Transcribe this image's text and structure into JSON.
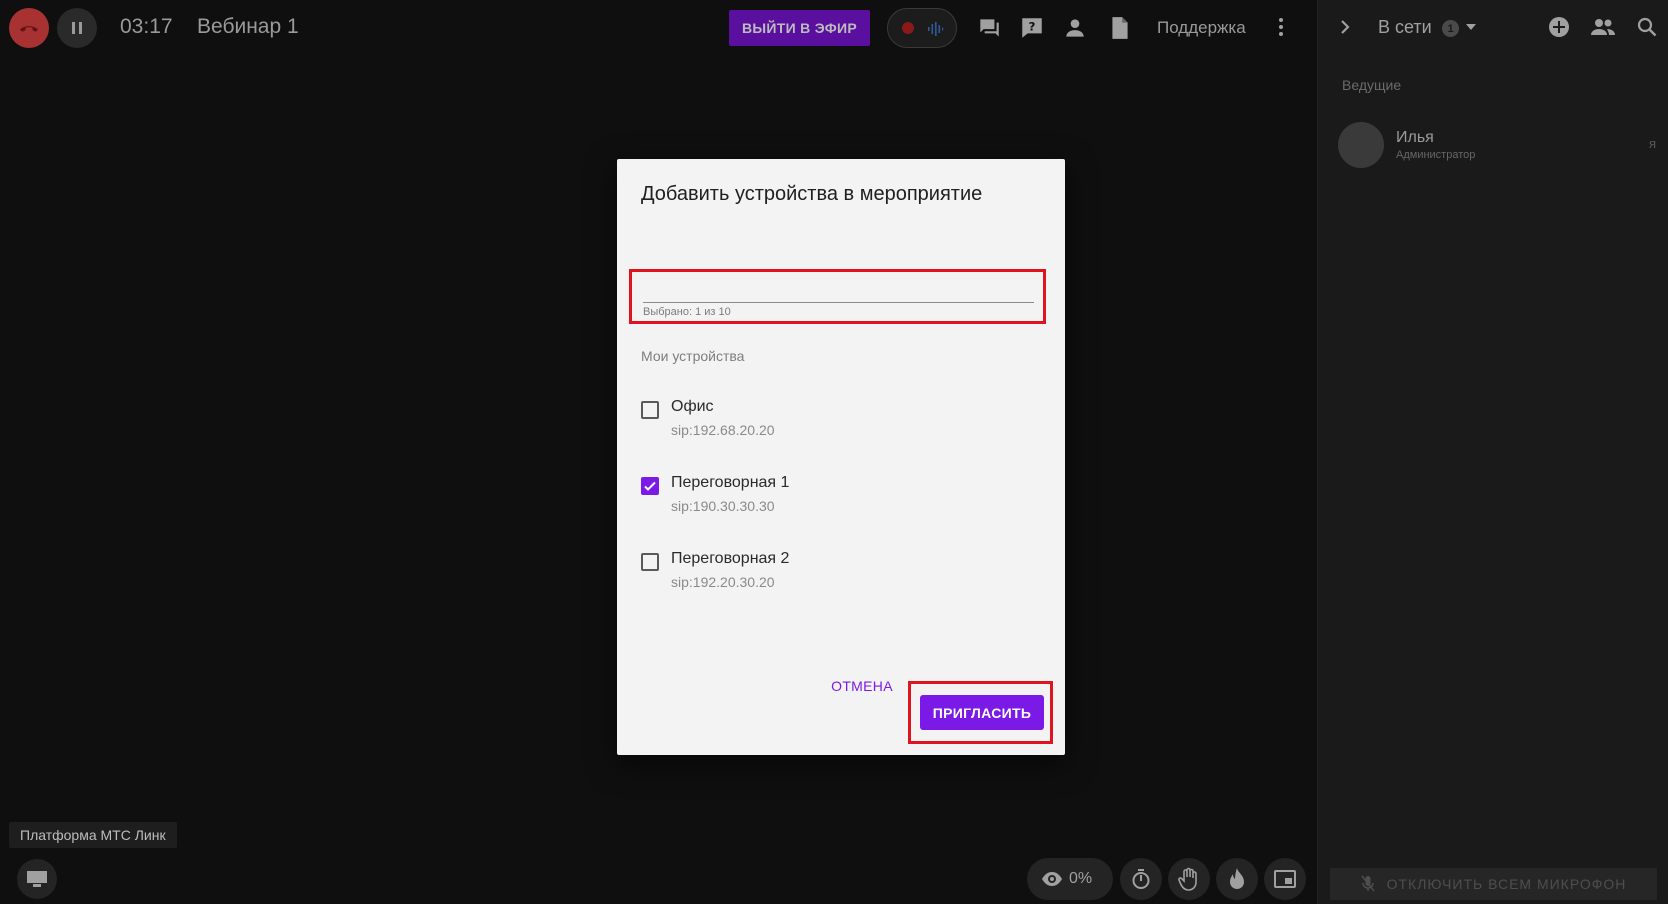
{
  "topbar": {
    "timer": "03:17",
    "event_title": "Вебинар 1",
    "go_live_label": "ВЫЙТИ В ЭФИР",
    "support_label": "Поддержка"
  },
  "bottom": {
    "platform_tooltip": "Платформа МТС Линк",
    "viewers_percent": "0%"
  },
  "dialog": {
    "title": "Добавить устройства в мероприятие",
    "selected_count": "Выбрано: 1 из 10",
    "section_label": "Мои устройства",
    "devices": [
      {
        "name": "Офис",
        "address": "sip:192.68.20.20",
        "checked": false
      },
      {
        "name": "Переговорная 1",
        "address": "sip:190.30.30.30",
        "checked": true
      },
      {
        "name": "Переговорная 2",
        "address": "sip:192.20.30.20",
        "checked": false
      }
    ],
    "cancel_label": "ОТМЕНА",
    "invite_label": "ПРИГЛАСИТЬ"
  },
  "side_panel": {
    "online_label": "В сети",
    "online_count": "1",
    "hosts_label": "Ведущие",
    "participants": [
      {
        "name": "Илья",
        "role": "Администратор",
        "me_label": "я"
      }
    ],
    "mute_all_label": "ОТКЛЮЧИТЬ ВСЕМ МИКРОФОН"
  },
  "colors": {
    "accent": "#7b19e6",
    "go_live_bg": "#5a0f9e",
    "hangup": "#a83232",
    "highlight": "#e0141e"
  }
}
